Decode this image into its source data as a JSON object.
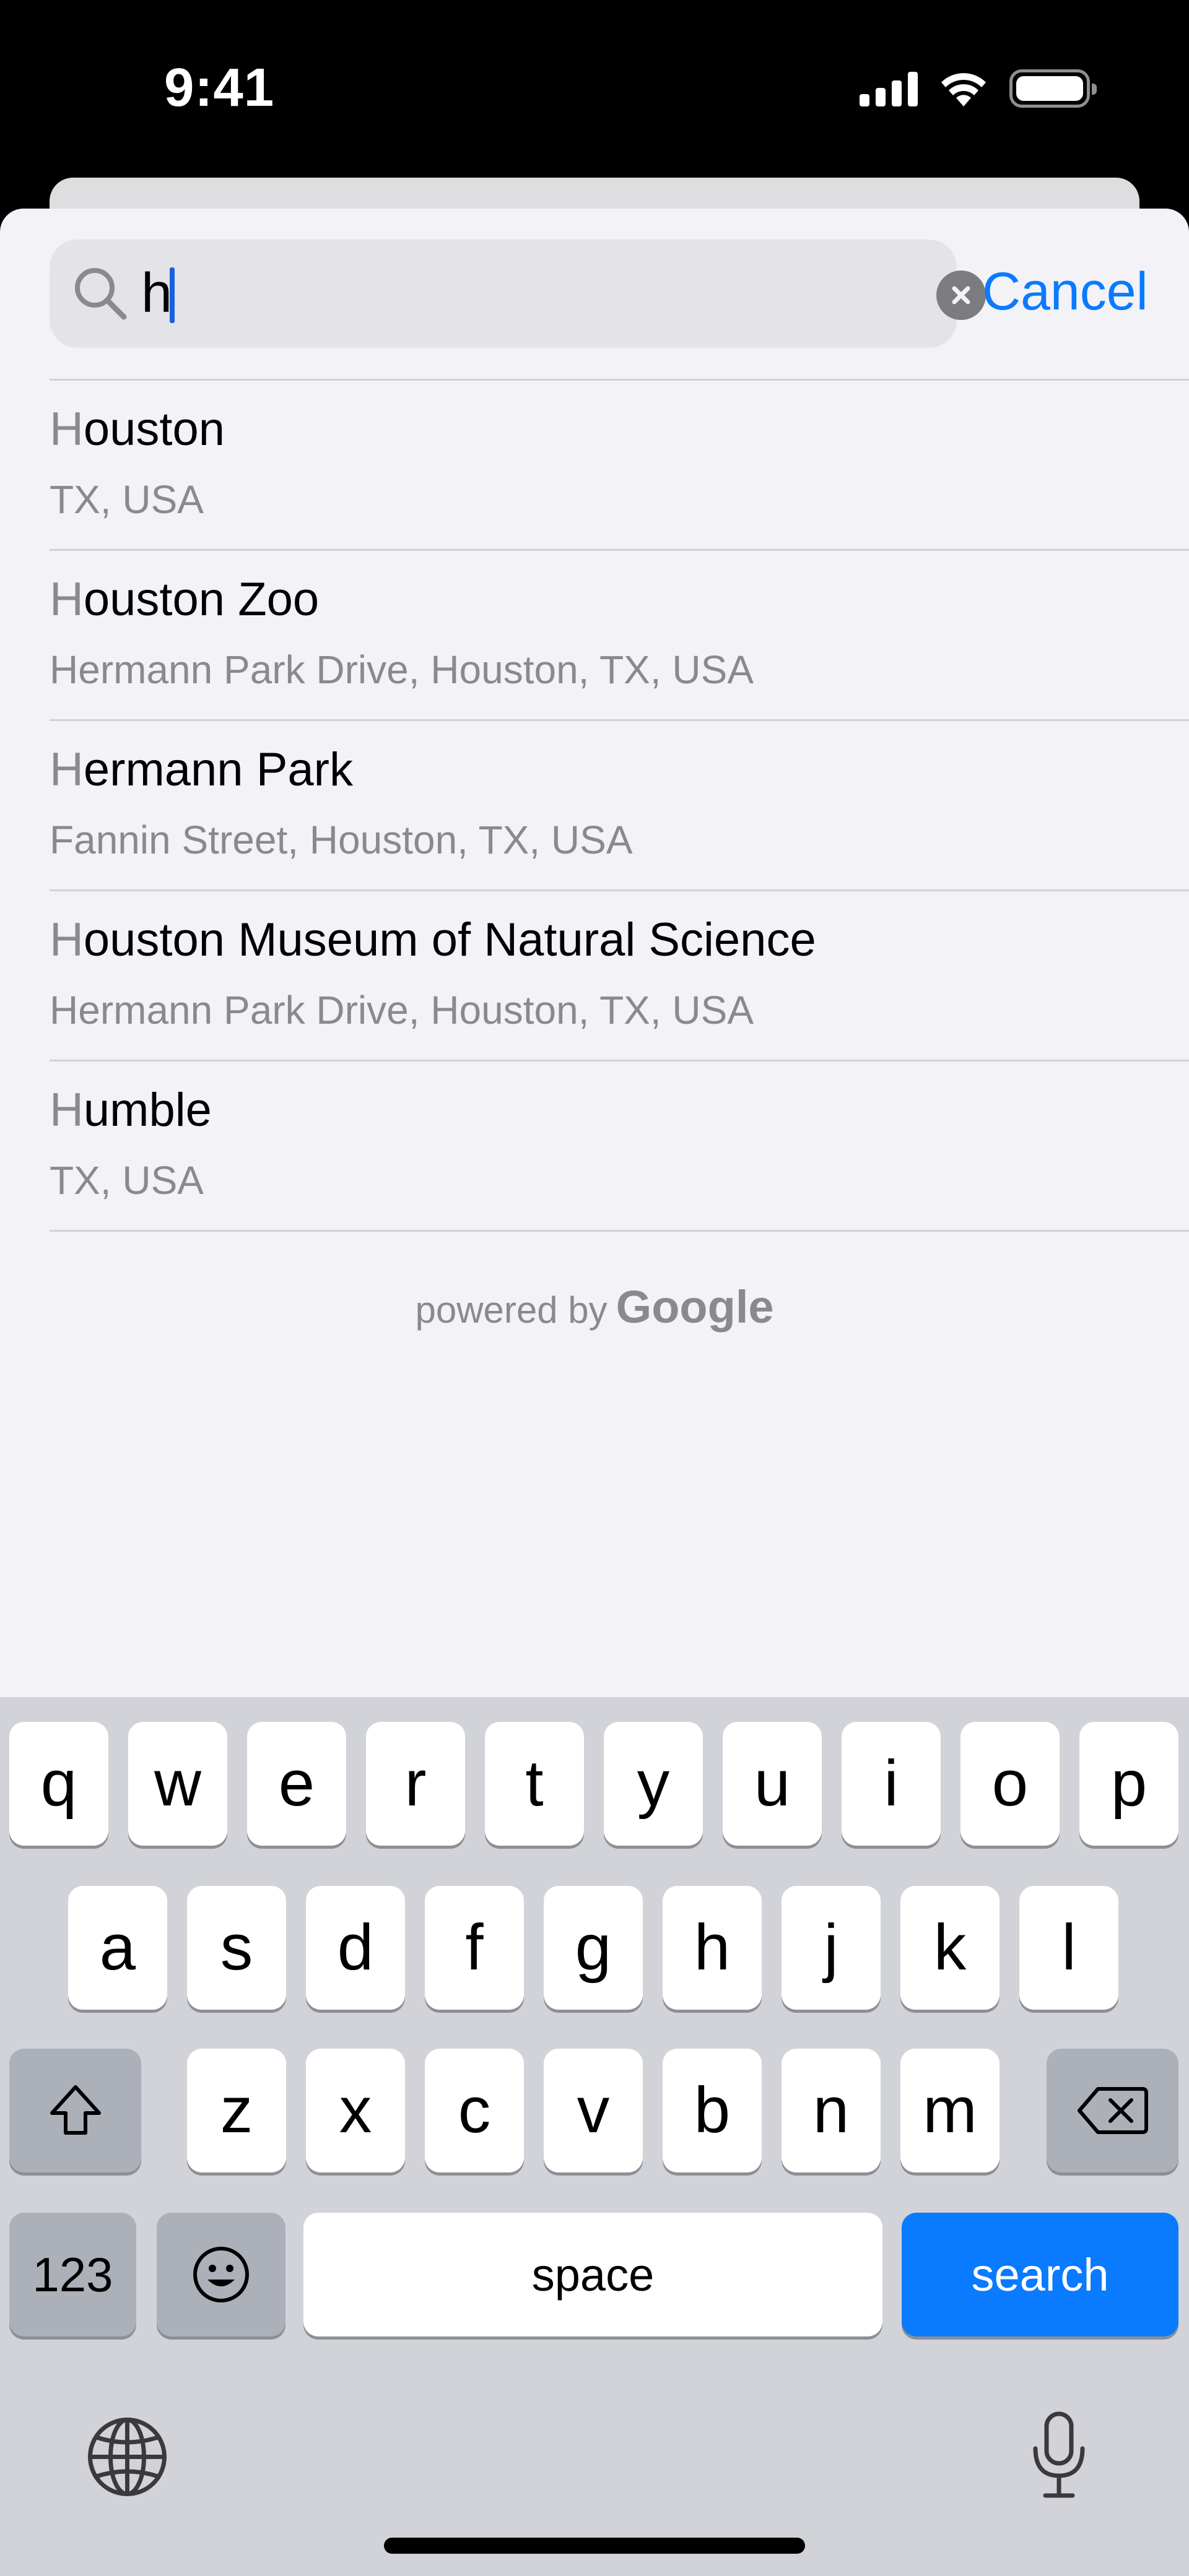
{
  "status_bar": {
    "time": "9:41"
  },
  "search": {
    "query": "h",
    "cancel_label": "Cancel"
  },
  "results": [
    {
      "title_first": "H",
      "title_rest": "ouston",
      "subtitle": "TX, USA"
    },
    {
      "title_first": "H",
      "title_rest": "ouston Zoo",
      "subtitle": "Hermann Park Drive, Houston, TX, USA"
    },
    {
      "title_first": "H",
      "title_rest": "ermann Park",
      "subtitle": "Fannin Street, Houston, TX, USA"
    },
    {
      "title_first": "H",
      "title_rest": "ouston Museum of Natural Science",
      "subtitle": "Hermann Park Drive, Houston, TX, USA"
    },
    {
      "title_first": "H",
      "title_rest": "umble",
      "subtitle": "TX, USA"
    }
  ],
  "attribution": {
    "prefix": "powered by",
    "brand": "Google"
  },
  "keyboard": {
    "row1": [
      "q",
      "w",
      "e",
      "r",
      "t",
      "y",
      "u",
      "i",
      "o",
      "p"
    ],
    "row2": [
      "a",
      "s",
      "d",
      "f",
      "g",
      "h",
      "j",
      "k",
      "l"
    ],
    "row3": [
      "z",
      "x",
      "c",
      "v",
      "b",
      "n",
      "m"
    ],
    "numbers_label": "123",
    "space_label": "space",
    "search_label": "search"
  },
  "colors": {
    "accent": "#0a7aff",
    "background": "#f2f2f7",
    "keyboard": "#d1d3d9"
  }
}
